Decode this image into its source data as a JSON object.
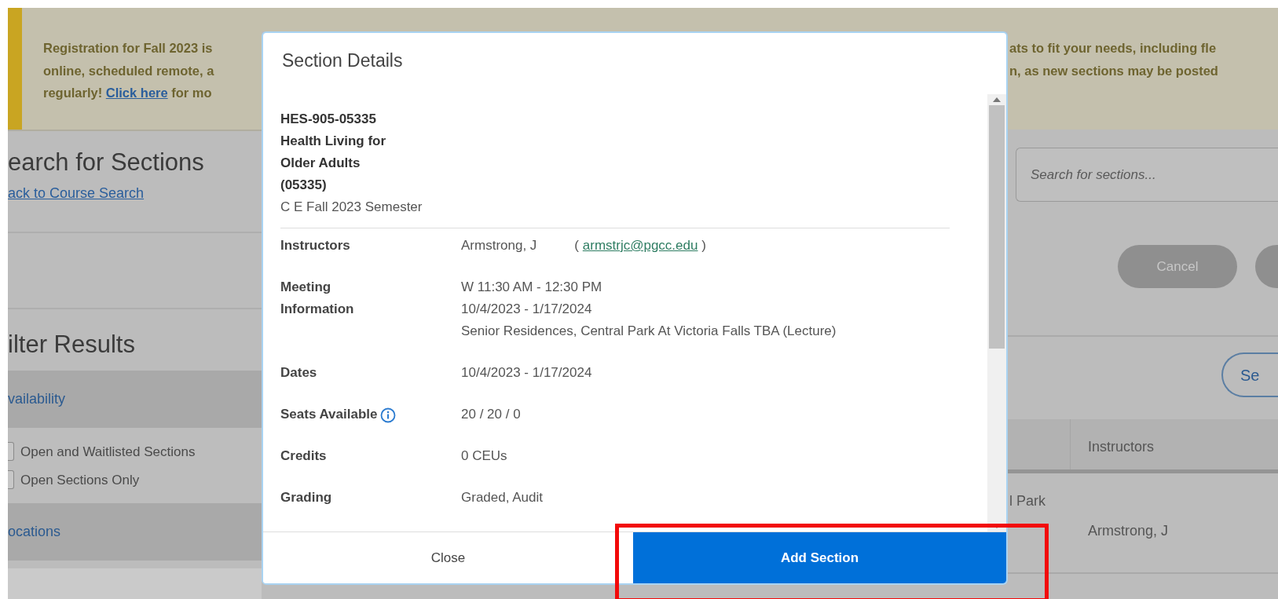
{
  "banner": {
    "left_lines": [
      {
        "text": "Registration for Fall 2023 is"
      },
      {
        "text": "online, scheduled remote, a"
      },
      {
        "text": "regularly! ",
        "link": "Click here",
        "after": " for mo"
      }
    ],
    "right_lines": [
      "ats to fit your needs, including fle",
      "n, as new sections may be posted"
    ]
  },
  "search_header": {
    "title": "earch for Sections",
    "back_link": "ack to Course Search"
  },
  "filter": {
    "title": "ilter Results",
    "groups": [
      {
        "label": "vailability",
        "options": [
          {
            "label": "Open and Waitlisted Sections",
            "checked": false
          },
          {
            "label": "Open Sections Only",
            "checked": false
          }
        ]
      },
      {
        "label": "ocations"
      }
    ]
  },
  "search": {
    "placeholder": "Search for sections..."
  },
  "actions": [
    {
      "label": "Cancel"
    }
  ],
  "section_button": {
    "label": "Se"
  },
  "table": {
    "header": "Instructors",
    "rows": [
      {
        "column_1": "l Park",
        "instructors": "Armstrong, J"
      }
    ]
  },
  "modal": {
    "title": "Section Details",
    "heading_lines": [
      "HES-905-05335",
      "Health Living for",
      "Older Adults",
      "(05335)"
    ],
    "term": "C E Fall 2023 Semester",
    "details": [
      {
        "kind": "instructor",
        "label": "Instructors",
        "value": "Armstrong, J",
        "email_open": "(",
        "email": "armstrjc@pgcc.edu",
        "email_close": ")"
      },
      {
        "kind": "lines",
        "label": "Meeting Information",
        "lines": [
          "W 11:30 AM - 12:30 PM",
          "10/4/2023 - 1/17/2024",
          "Senior Residences, Central Park At Victoria Falls TBA (Lecture)"
        ]
      },
      {
        "kind": "text",
        "label": "Dates",
        "value": "10/4/2023 - 1/17/2024"
      },
      {
        "kind": "text",
        "label": "Seats Available",
        "info": true,
        "value": "20 / 20 / 0"
      },
      {
        "kind": "text",
        "label": "Credits",
        "value": "0 CEUs"
      },
      {
        "kind": "text",
        "label": "Grading",
        "value": "Graded, Audit"
      }
    ],
    "footer_buttons": [
      {
        "kind": "secondary",
        "label": "Close"
      },
      {
        "kind": "primary",
        "label": "Add Section",
        "highlighted": true
      }
    ]
  }
}
